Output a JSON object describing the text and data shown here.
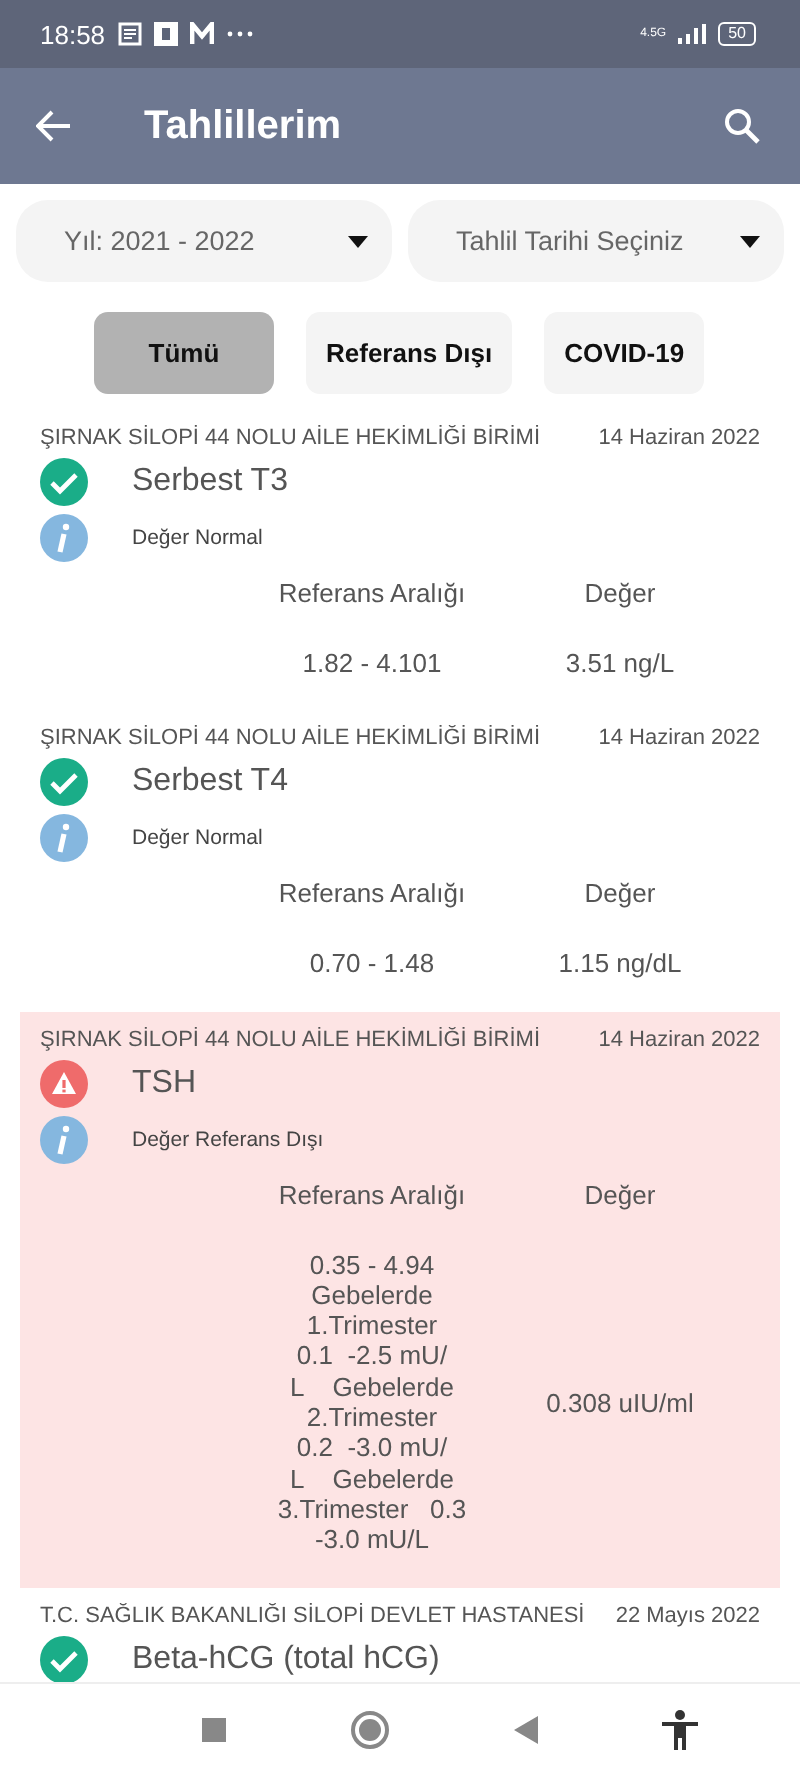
{
  "status_bar": {
    "time": "18:58",
    "battery": "50",
    "network": "4.5G"
  },
  "app_bar": {
    "title": "Tahlillerim"
  },
  "filters": [
    {
      "value": "Yıl: 2021 - 2022"
    },
    {
      "value": "Tahlil Tarihi Seçiniz"
    }
  ],
  "chips": [
    {
      "label": "Tümü",
      "selected": true
    },
    {
      "label": "Referans Dışı",
      "selected": false
    },
    {
      "label": "COVID-19",
      "selected": false
    }
  ],
  "results": [
    {
      "institution": "ŞIRNAK SİLOPİ 44 NOLU AİLE HEKİMLİĞİ BİRİMİ",
      "date": "14 Haziran 2022",
      "test": "Serbest T3",
      "kind": "normal",
      "note": "Değer Normal",
      "range_label": "Referans Aralığı",
      "value_label": "Değer",
      "range_lines": [
        "1.82 - 4.101"
      ],
      "value": "3.51 ng/L"
    },
    {
      "institution": "ŞIRNAK SİLOPİ 44 NOLU AİLE HEKİMLİĞİ BİRİMİ",
      "date": "14 Haziran 2022",
      "test": "Serbest T4",
      "kind": "normal",
      "note": "Değer Normal",
      "range_label": "Referans Aralığı",
      "value_label": "Değer",
      "range_lines": [
        "0.70 - 1.48"
      ],
      "value": "1.15 ng/dL"
    },
    {
      "institution": "ŞIRNAK SİLOPİ 44 NOLU AİLE HEKİMLİĞİ BİRİMİ",
      "date": "14 Haziran 2022",
      "test": "TSH",
      "kind": "abnormal",
      "note": "Değer Referans Dışı",
      "range_label": "Referans Aralığı",
      "value_label": "Değer",
      "range_lines": [
        "0.35 - 4.94",
        "Gebelerde",
        "1.Trimester",
        "0.1  -2.5 mU/",
        "L    Gebelerde",
        "2.Trimester",
        "0.2  -3.0 mU/",
        "L    Gebelerde",
        "3.Trimester   0.3",
        "-3.0 mU/L"
      ],
      "value": "0.308 uIU/ml"
    },
    {
      "institution": "T.C. SAĞLIK BAKANLIĞI SİLOPİ DEVLET HASTANESİ",
      "date": "22 Mayıs 2022",
      "test": "Beta-hCG (total hCG)",
      "kind": "normal"
    }
  ]
}
